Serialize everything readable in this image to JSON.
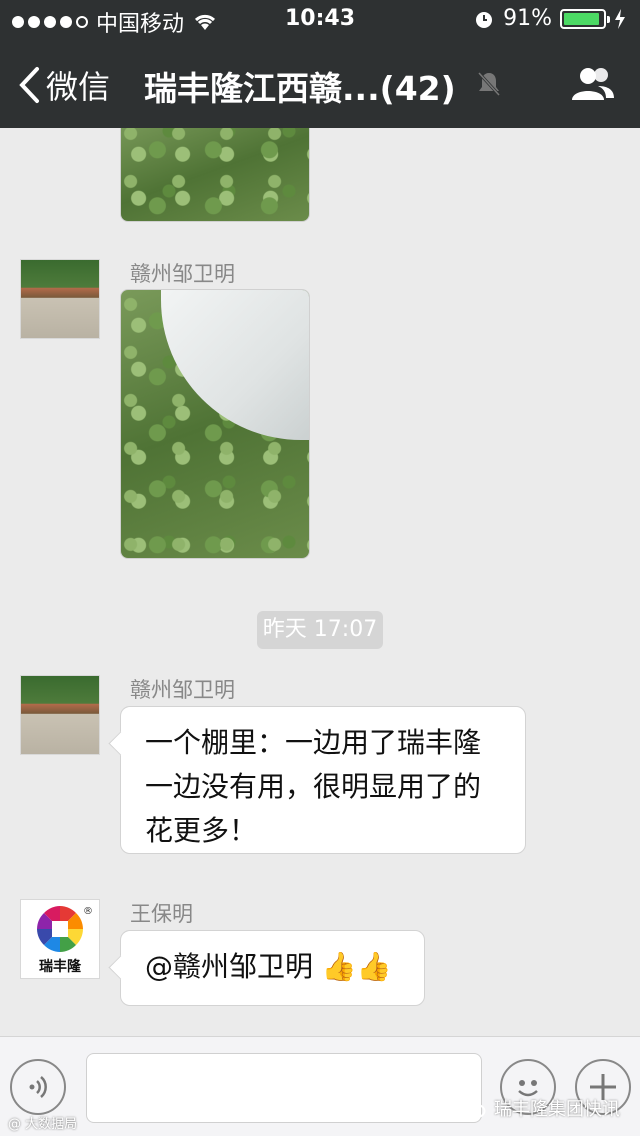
{
  "status_bar": {
    "carrier": "中国移动",
    "time": "10:43",
    "battery_percent": "91%",
    "battery_level": 0.91
  },
  "nav": {
    "back_label": "微信",
    "title": "瑞丰隆江西赣...(42)"
  },
  "messages": [
    {
      "sender": "赣州邹卫明",
      "type": "image"
    },
    {
      "timestamp": "昨天 17:07"
    },
    {
      "sender": "赣州邹卫明",
      "type": "text",
      "lines": [
        "一个棚里：一边用了瑞丰隆",
        "一边没有用，很明显用了的",
        "花更多！"
      ]
    },
    {
      "sender": "王保明",
      "type": "text",
      "text": "@赣州邹卫明 👍👍",
      "avatar_text": "瑞丰隆"
    }
  ],
  "watermark": {
    "text": "瑞丰隆集团快讯",
    "small": "@ 大数据局"
  },
  "colors": {
    "bar_bg": "#2e3132",
    "chat_bg": "#ebebeb",
    "battery": "#4cd964"
  }
}
